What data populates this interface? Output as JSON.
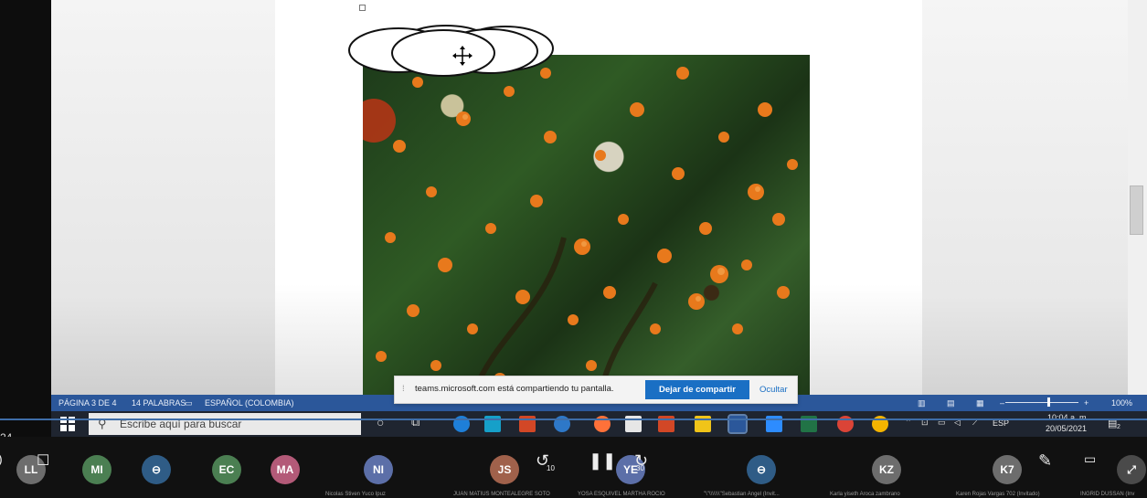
{
  "word_status": {
    "page": "PÁGINA 3 DE 4",
    "words": "14 PALABRAS",
    "language": "ESPAÑOL (COLOMBIA)",
    "zoom": "100%"
  },
  "share_notice": {
    "message": "teams.microsoft.com está compartiendo tu pantalla.",
    "stop_label": "Dejar de compartir",
    "hide_label": "Ocultar"
  },
  "taskbar": {
    "search_placeholder": "Escribe aquí para buscar",
    "language": "ESP",
    "time": "10:04 a. m.",
    "date": "20/05/2021",
    "notifications": "2"
  },
  "player": {
    "time_left": "24",
    "rewind_label": "10",
    "forward_label": "30"
  },
  "participants": [
    {
      "initials": "LL",
      "name": "",
      "color": "#6d6d6d"
    },
    {
      "initials": "MI",
      "name": "",
      "color": "#4b7f52"
    },
    {
      "initials": "",
      "name": "",
      "color": "#2f5c86"
    },
    {
      "initials": "EC",
      "name": "",
      "color": "#4b7f52"
    },
    {
      "initials": "MA",
      "name": "",
      "color": "#b35a78"
    },
    {
      "initials": "NI",
      "name": "Nicolas Stiven Yuco Ipuz",
      "color": "#5c6fa8"
    },
    {
      "initials": "JS",
      "name": "JUAN MATIUS MONTEALEGRE SOTO",
      "color": "#a0614b"
    },
    {
      "initials": "YE",
      "name": "YOSA ESQUIVEL MARTHA ROCIO",
      "color": "#5c6fa8"
    },
    {
      "initials": "",
      "name": "\"\\\"\\\\\\\\\\\\\\\"Sebastian  Angel (Invit...",
      "color": "#2f5c86"
    },
    {
      "initials": "KZ",
      "name": "Karla yiseth Aroca zambrano",
      "color": "#6d6d6d"
    },
    {
      "initials": "K7",
      "name": "Karen Rojas Vargas 702 (Invitado)",
      "color": "#6d6d6d"
    },
    {
      "initials": "",
      "name": "INGRID DUSSAN (Inv",
      "color": "#6d6d6d"
    }
  ]
}
